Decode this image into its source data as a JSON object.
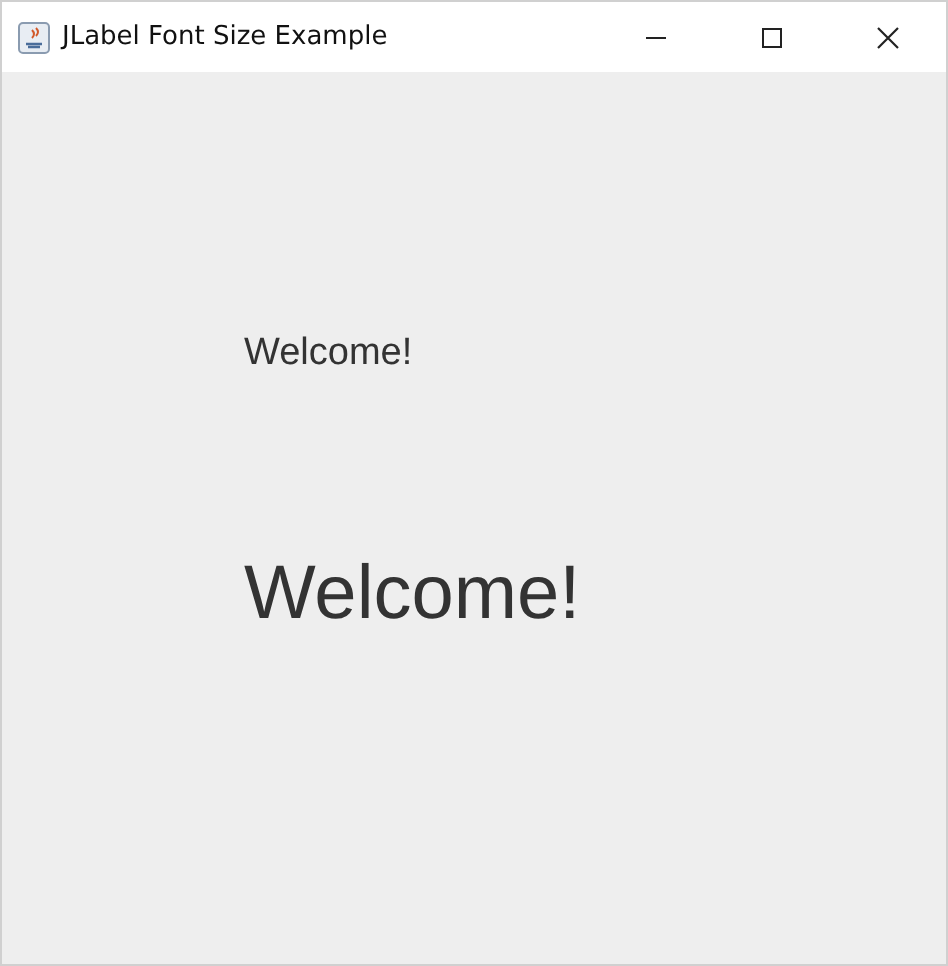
{
  "window": {
    "title": "JLabel Font Size Example"
  },
  "labels": [
    {
      "text": "Welcome!",
      "kind": "small"
    },
    {
      "text": "Welcome!",
      "kind": "large"
    }
  ]
}
